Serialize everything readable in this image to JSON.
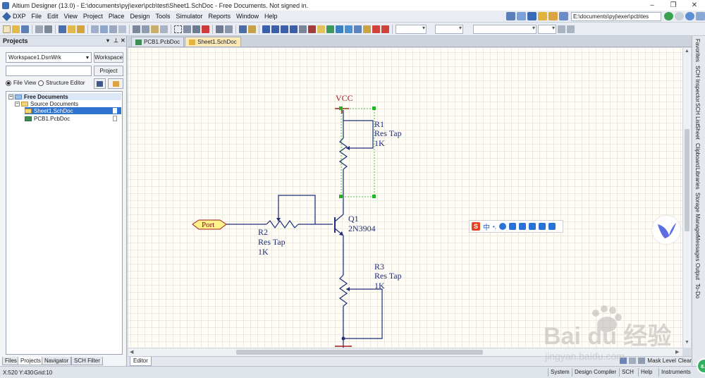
{
  "window": {
    "title": "Altium Designer (13.0) - E:\\documents\\pyj\\exer\\pcb\\test\\Sheet1.SchDoc - Free Documents. Not signed in.",
    "controls": [
      "–",
      "❐",
      "✕"
    ]
  },
  "menu": {
    "items": [
      "DXP",
      "File",
      "Edit",
      "View",
      "Project",
      "Place",
      "Design",
      "Tools",
      "Simulator",
      "Reports",
      "Window",
      "Help"
    ],
    "path": "E:\\documents\\pyj\\exer\\pcb\\tes"
  },
  "projects_panel": {
    "title": "Projects",
    "workspace_select": "Workspace1.DsnWrk",
    "workspace_button": "Workspace",
    "project_button": "Project",
    "radio_file_view": "File View",
    "radio_structure_editor": "Structure Editor",
    "tree": {
      "root": "Free Documents",
      "folder": "Source Documents",
      "files": [
        "Sheet1.SchDoc",
        "PCB1.PcbDoc"
      ]
    },
    "bottom_tabs": [
      "Files",
      "Projects",
      "Navigator",
      "SCH Filter"
    ]
  },
  "document_tabs": [
    "PCB1.PcbDoc",
    "Sheet1.SchDoc"
  ],
  "schematic": {
    "power_label": "VCC",
    "port_label": "Port",
    "r1": {
      "designator": "R1",
      "comment": "Res Tap",
      "value": "1K"
    },
    "r2": {
      "designator": "R2",
      "comment": "Res Tap",
      "value": "1K"
    },
    "r3": {
      "designator": "R3",
      "comment": "Res Tap",
      "value": "1K"
    },
    "q1": {
      "designator": "Q1",
      "comment": "2N3904"
    }
  },
  "ime_toolbar": {
    "logo": "S",
    "mode": "中",
    "punct": "•,"
  },
  "editor_strip": {
    "tab": "Editor",
    "right_items": [
      "Mask Level",
      "Clear"
    ]
  },
  "side_tabs": [
    "Favorites",
    "SCH Inspector",
    "SCH List",
    "Sheet",
    "Clipboard",
    "Libraries",
    "Storage Manager",
    "Messages",
    "Output",
    "To-Do"
  ],
  "status_bar": {
    "coords": "X:520 Y:430",
    "grid": "Grid:10",
    "buttons": [
      "System",
      "Design Compiler",
      "SCH",
      "Help",
      "Instruments"
    ]
  },
  "badge": "8.3",
  "watermark": {
    "brand": "Bai du 经验",
    "url": "jingyan.baidu.com"
  },
  "colors": {
    "wire": "#1d2d7a",
    "power": "#a11a1a",
    "selection": "#22b322",
    "port_fill": "#fff38a",
    "tree_selected": "#2f74d0"
  }
}
